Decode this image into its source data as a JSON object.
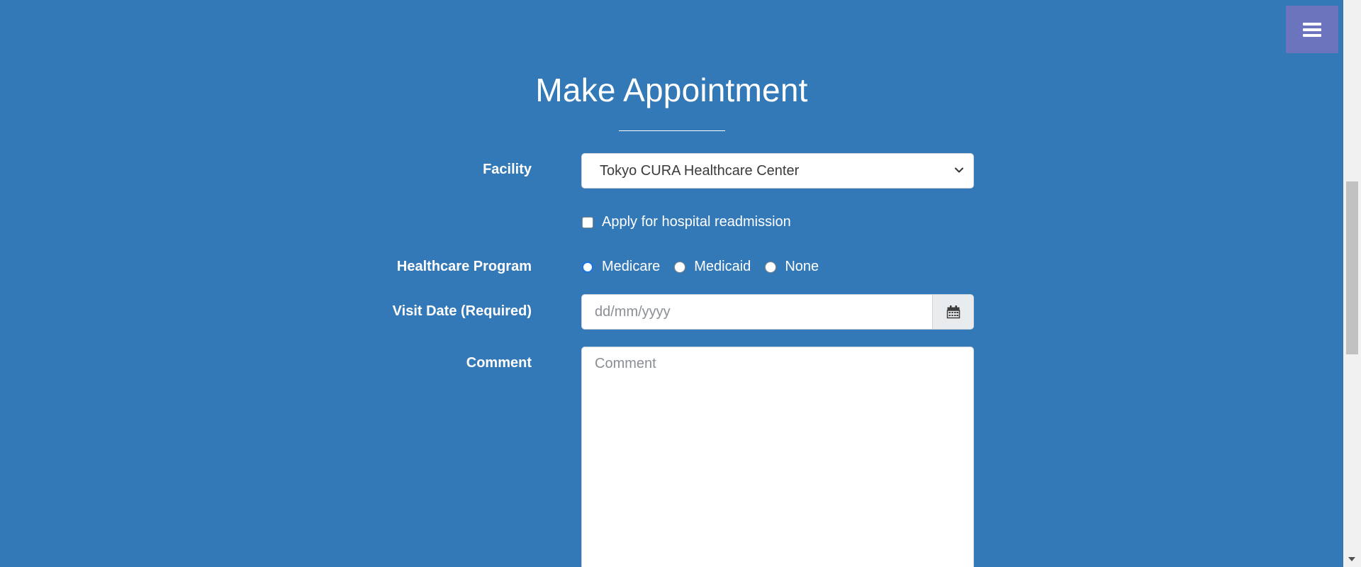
{
  "header": {
    "title": "Make Appointment",
    "menu_icon": "hamburger-menu-icon"
  },
  "form": {
    "facility": {
      "label": "Facility",
      "selected": "Tokyo CURA Healthcare Center",
      "icon": "chevron-down-icon"
    },
    "readmission": {
      "label": "Apply for hospital readmission",
      "checked": false
    },
    "program": {
      "label": "Healthcare Program",
      "options": [
        "Medicare",
        "Medicaid",
        "None"
      ],
      "selected": "Medicare"
    },
    "visit_date": {
      "label": "Visit Date (Required)",
      "placeholder": "dd/mm/yyyy",
      "value": "",
      "icon": "calendar-icon"
    },
    "comment": {
      "label": "Comment",
      "placeholder": "Comment",
      "value": ""
    }
  },
  "colors": {
    "background": "#3479b7",
    "menu_button": "#6c74bd",
    "radio_accent": "#1a73e8"
  }
}
